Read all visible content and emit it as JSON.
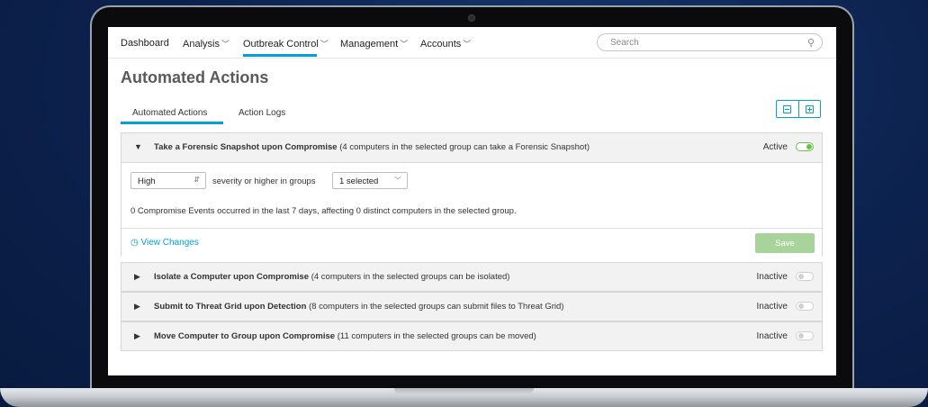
{
  "nav": {
    "items": [
      {
        "label": "Dashboard",
        "has_chevron": false
      },
      {
        "label": "Analysis",
        "has_chevron": true
      },
      {
        "label": "Outbreak Control",
        "has_chevron": true
      },
      {
        "label": "Management",
        "has_chevron": true
      },
      {
        "label": "Accounts",
        "has_chevron": true
      }
    ],
    "active": "Outbreak Control",
    "search_placeholder": "Search"
  },
  "page": {
    "title": "Automated Actions"
  },
  "tabs": [
    {
      "label": "Automated Actions",
      "active": true
    },
    {
      "label": "Action Logs",
      "active": false
    }
  ],
  "panels": [
    {
      "title": "Take a Forensic Snapshot upon Compromise",
      "description": "(4 computers in the selected group can take a Forensic Snapshot)",
      "state": "Active",
      "enabled": true,
      "expanded": true,
      "severity": "High",
      "severity_suffix": "severity or higher in groups",
      "groups": "1 selected",
      "events_text": "0 Compromise Events occurred in the last 7 days, affecting 0 distinct computers in the selected group.",
      "view_changes": "View Changes",
      "save": "Save"
    },
    {
      "title": "Isolate a Computer upon Compromise",
      "description": "(4 computers in the selected groups can be isolated)",
      "state": "Inactive",
      "enabled": false
    },
    {
      "title": "Submit to Threat Grid upon Detection",
      "description": "(8 computers in the selected groups can submit files to Threat Grid)",
      "state": "Inactive",
      "enabled": false
    },
    {
      "title": "Move Computer to Group upon Compromise",
      "description": "(11 computers in the selected groups can be moved)",
      "state": "Inactive",
      "enabled": false
    }
  ],
  "colors": {
    "accent": "#049fd9",
    "active_toggle": "#6cc04a",
    "save_button": "#a8d39a"
  },
  "icons": [
    "search-icon",
    "collapse-all-icon",
    "expand-all-icon",
    "chevron-down-icon",
    "triangle-right-icon",
    "triangle-down-icon",
    "clock-icon"
  ]
}
